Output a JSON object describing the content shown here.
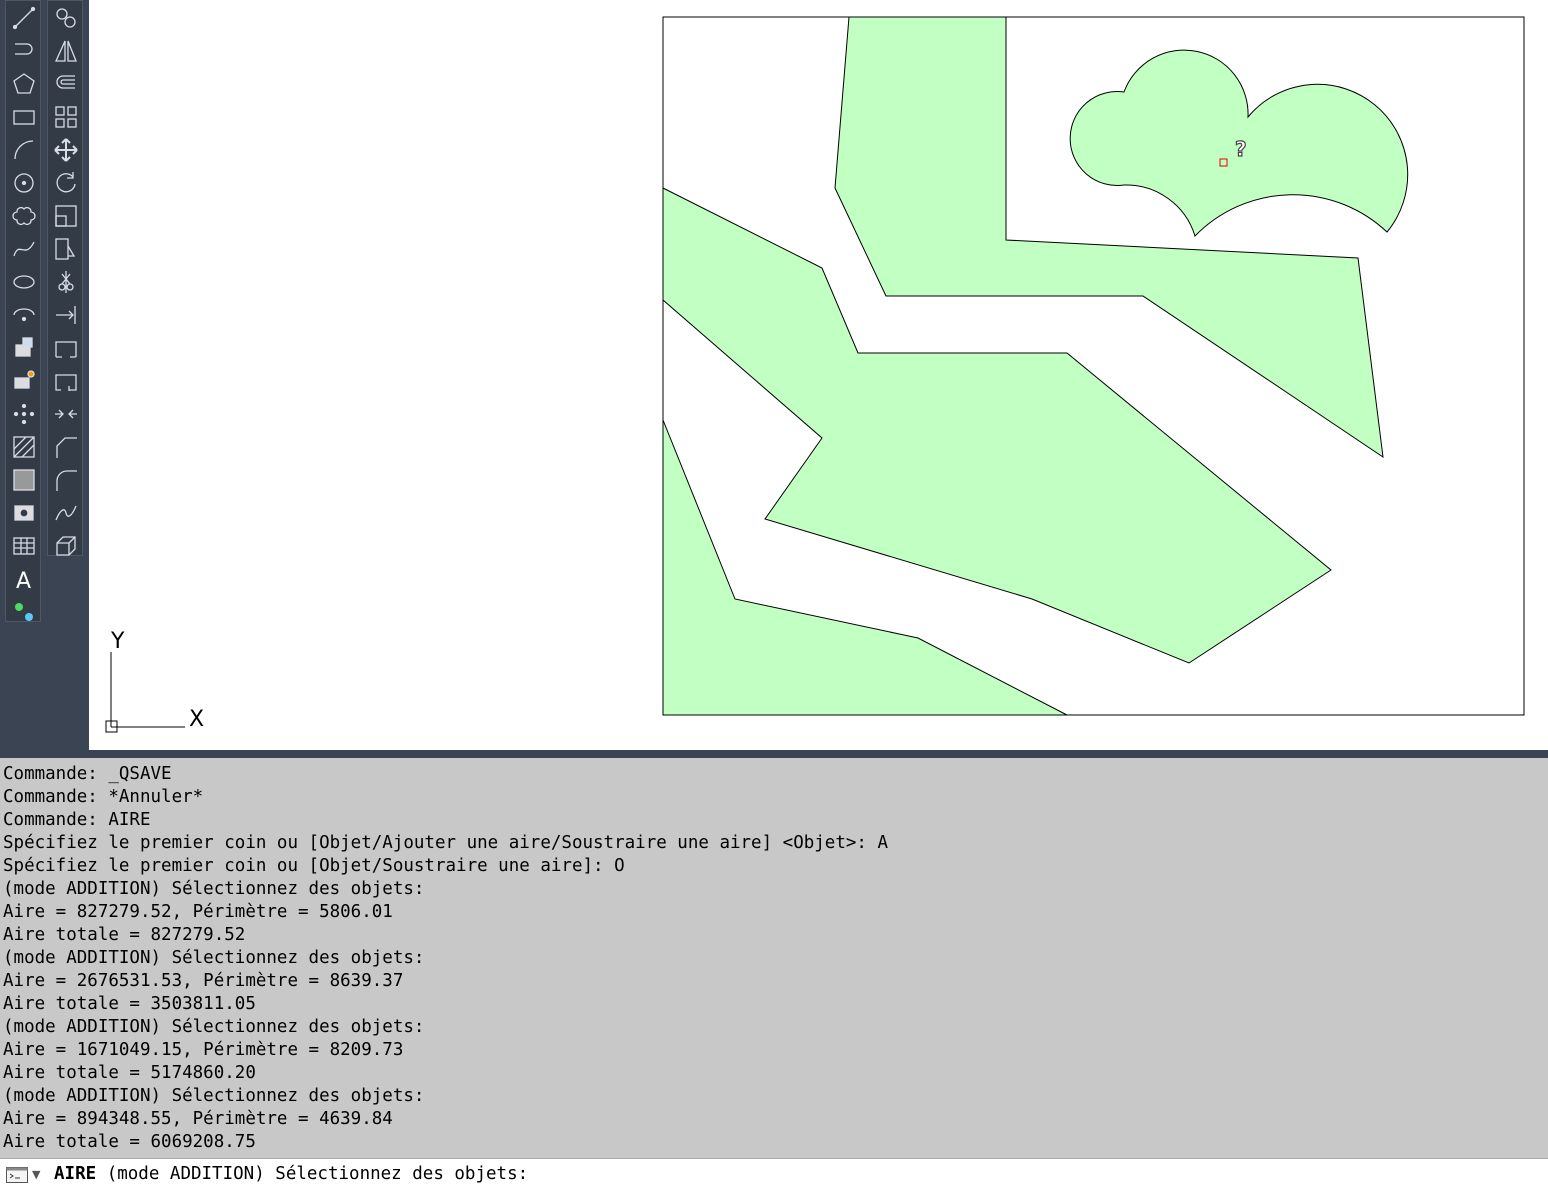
{
  "toolbar": {
    "draw_tools": [
      "line-icon",
      "polyline-icon",
      "polygon-icon",
      "rectangle-icon",
      "arc-icon",
      "circle-icon",
      "revision-cloud-icon",
      "spline-icon",
      "ellipse-icon",
      "ellipse-arc-icon",
      "insert-block-icon",
      "make-block-icon",
      "point-icon",
      "hatch-icon",
      "gradient-icon",
      "region-icon",
      "table-icon",
      "multiline-text-icon",
      "add-selected-icon"
    ],
    "modify_tools": [
      "copy-icon",
      "mirror-icon",
      "offset-icon",
      "array-icon",
      "move-icon",
      "rotate-icon",
      "scale-icon",
      "stretch-icon",
      "trim-icon",
      "extend-icon",
      "break-at-point-icon",
      "break-icon",
      "join-icon",
      "chamfer-icon",
      "fillet-icon",
      "blend-curves-icon",
      "explode-icon"
    ]
  },
  "drawing": {
    "fill_color": "#c2ffc2",
    "stroke_color": "#000000",
    "cursor_glyph": "?",
    "ucs": {
      "x_label": "X",
      "y_label": "Y"
    }
  },
  "command_history": [
    "Commande:",
    "Commande: _QSAVE",
    "Commande: *Annuler*",
    "Commande: AIRE",
    "Spécifiez le premier coin ou [Objet/Ajouter une aire/Soustraire une aire] <Objet>: A",
    "Spécifiez le premier coin ou [Objet/Soustraire une aire]: O",
    "(mode ADDITION) Sélectionnez des objets:",
    "Aire = 827279.52, Périmètre = 5806.01",
    "Aire totale = 827279.52",
    "(mode ADDITION) Sélectionnez des objets:",
    "Aire = 2676531.53, Périmètre = 8639.37",
    "Aire totale = 3503811.05",
    "(mode ADDITION) Sélectionnez des objets:",
    "Aire = 1671049.15, Périmètre = 8209.73",
    "Aire totale = 5174860.20",
    "(mode ADDITION) Sélectionnez des objets:",
    "Aire = 894348.55, Périmètre = 4639.84",
    "Aire totale = 6069208.75"
  ],
  "command_line": {
    "command_name": "AIRE",
    "prompt": "(mode ADDITION) Sélectionnez des objets:",
    "input_value": ""
  }
}
